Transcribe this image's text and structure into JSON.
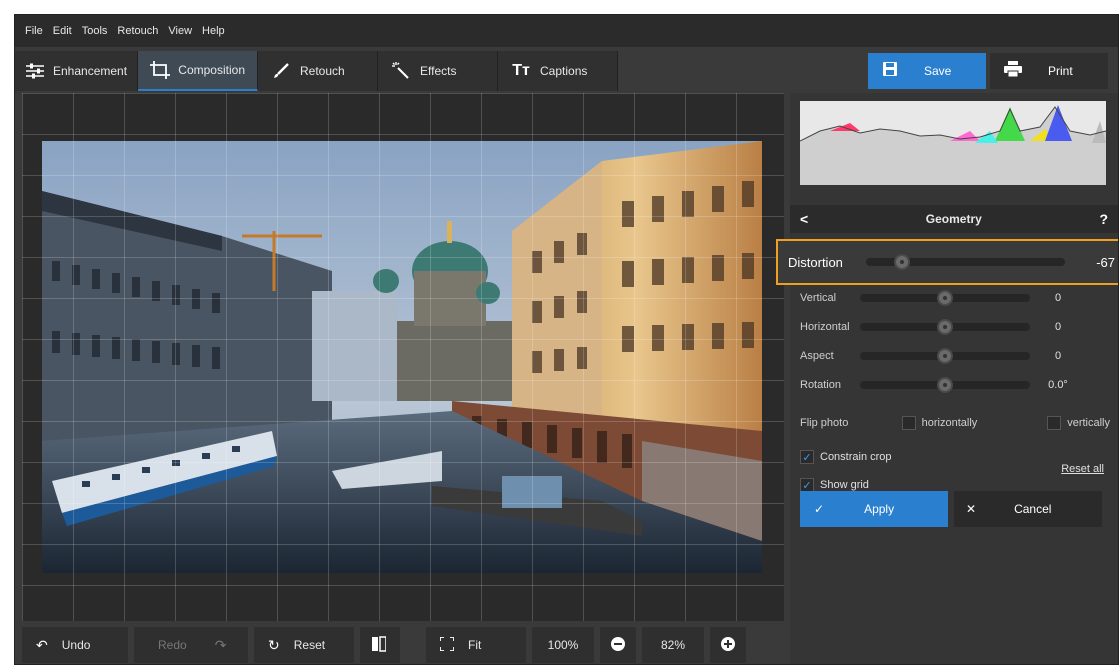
{
  "menu": [
    "File",
    "Edit",
    "Tools",
    "Retouch",
    "View",
    "Help"
  ],
  "tabs": [
    {
      "label": "Enhancement",
      "icon": "sliders-icon"
    },
    {
      "label": "Composition",
      "icon": "crop-icon"
    },
    {
      "label": "Retouch",
      "icon": "brush-icon"
    },
    {
      "label": "Effects",
      "icon": "magic-wand-icon"
    },
    {
      "label": "Captions",
      "icon": "text-icon",
      "glyph": "Tт"
    }
  ],
  "actions": {
    "save_label": "Save",
    "print_label": "Print"
  },
  "bottombar": {
    "undo_label": "Undo",
    "redo_label": "Redo",
    "reset_label": "Reset",
    "fit_label": "Fit",
    "zoom_100": "100%",
    "zoom_value": "82%"
  },
  "geometry": {
    "title": "Geometry",
    "back_glyph": "<",
    "help_glyph": "?",
    "distortion": {
      "label": "Distortion",
      "value": "-67",
      "level": -67
    },
    "sliders": [
      {
        "label": "Vertical",
        "value": "0"
      },
      {
        "label": "Horizontal",
        "value": "0"
      },
      {
        "label": "Aspect",
        "value": "0"
      },
      {
        "label": "Rotation",
        "value": "0.0°"
      }
    ],
    "flip_label": "Flip photo",
    "flip_h_label": "horizontally",
    "flip_v_label": "vertically",
    "constrain_label": "Constrain crop",
    "show_grid_label": "Show grid",
    "reset_all_label": "Reset all",
    "apply_label": "Apply",
    "cancel_label": "Cancel"
  },
  "colors": {
    "accent": "#2a7fcf",
    "highlight": "#f0a020"
  }
}
